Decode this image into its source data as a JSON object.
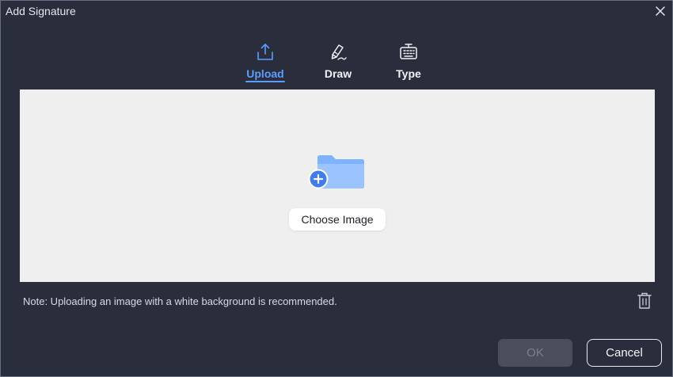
{
  "window": {
    "title": "Add Signature",
    "close_icon": "close-icon"
  },
  "tabs": [
    {
      "label": "Upload",
      "icon": "upload-icon",
      "active": true
    },
    {
      "label": "Draw",
      "icon": "pen-icon",
      "active": false
    },
    {
      "label": "Type",
      "icon": "keyboard-icon",
      "active": false
    }
  ],
  "upload_area": {
    "illustration": "add-folder-icon",
    "choose_label": "Choose Image"
  },
  "note": "Note: Uploading an image with a white background is recommended.",
  "delete_icon": "trash-icon",
  "footer": {
    "ok_label": "OK",
    "cancel_label": "Cancel"
  },
  "colors": {
    "accent": "#5b9dff",
    "background": "#2a2d3c",
    "upload_area": "#efefef",
    "folder": "#7fb2ff",
    "folder_plus_badge": "#3e7cf0"
  }
}
